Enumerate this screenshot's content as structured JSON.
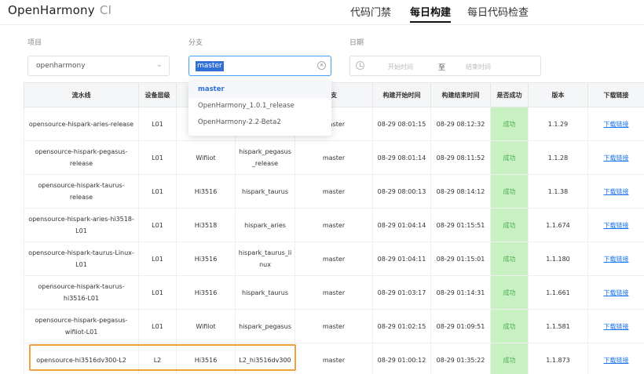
{
  "header": {
    "brand": "OpenHarmony",
    "brand_suffix": "CI",
    "nav": [
      "代码门禁",
      "每日构建",
      "每日代码检查"
    ]
  },
  "filters": {
    "project_label": "项目",
    "project_value": "openharmony",
    "branch_label": "分支",
    "branch_value": "master",
    "date_label": "日期",
    "date_start_placeholder": "开始时间",
    "date_sep": "至",
    "date_end_placeholder": "结束时间"
  },
  "dropdown": {
    "options": [
      "master",
      "OpenHarmony_1.0.1_release",
      "OpenHarmony-2.2-Beta2"
    ]
  },
  "table": {
    "headers": [
      "流水线",
      "设备层级",
      "",
      "支",
      "构建开始时间",
      "构建结束时间",
      "是否成功",
      "版本",
      "下载链接"
    ],
    "rows": [
      [
        "opensource-hispark-aries-release",
        "L01",
        "",
        "",
        "master",
        "08-29 08:01:15",
        "08-29 08:12:32",
        "成功",
        "1.1.29",
        "下载链接"
      ],
      [
        "opensource-hispark-pegasus-release",
        "L01",
        "Wifiiot",
        "hispark_pegasus_release",
        "master",
        "08-29 08:01:14",
        "08-29 08:11:52",
        "成功",
        "1.1.28",
        "下载链接"
      ],
      [
        "opensource-hispark-taurus-release",
        "L01",
        "Hi3516",
        "hispark_taurus",
        "master",
        "08-29 08:00:13",
        "08-29 08:14:12",
        "成功",
        "1.1.38",
        "下载链接"
      ],
      [
        "opensource-hispark-aries-hi3518-L01",
        "L01",
        "Hi3518",
        "hispark_aries",
        "master",
        "08-29 01:04:14",
        "08-29 01:15:51",
        "成功",
        "1.1.674",
        "下载链接"
      ],
      [
        "opensource-hispark-taurus-Linux-L01",
        "L01",
        "Hi3516",
        "hispark_taurus_linux",
        "master",
        "08-29 01:04:11",
        "08-29 01:15:01",
        "成功",
        "1.1.180",
        "下载链接"
      ],
      [
        "opensource-hispark-taurus-hi3516-L01",
        "L01",
        "Hi3516",
        "hispark_taurus",
        "master",
        "08-29 01:03:17",
        "08-29 01:14:31",
        "成功",
        "1.1.661",
        "下载链接"
      ],
      [
        "opensource-hispark-pegasus-wifiiot-L01",
        "L01",
        "Wifiiot",
        "hispark_pegasus",
        "master",
        "08-29 01:02:15",
        "08-29 01:09:51",
        "成功",
        "1.1.581",
        "下载链接"
      ],
      [
        "opensource-hi3516dv300-L2",
        "L2",
        "Hi3516",
        "L2_hi3516dv300",
        "master",
        "08-29 01:00:12",
        "08-29 01:35:22",
        "成功",
        "1.1.873",
        "下载链接"
      ]
    ]
  },
  "colors": {
    "accent": "#409eff",
    "success_bg": "#c8f0c3",
    "link": "#1a73e8",
    "highlight": "#f0a040"
  }
}
